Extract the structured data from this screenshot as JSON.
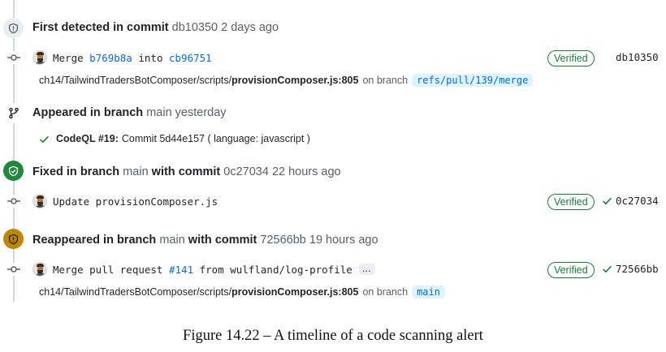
{
  "events": [
    {
      "title_bold": "First detected in commit",
      "title_rest": "db10350 2 days ago"
    },
    {
      "title_bold": "Appeared in branch",
      "title_rest": "main yesterday"
    },
    {
      "title_bold": "Fixed in branch",
      "title_mid": "main",
      "title_bold2": "with commit",
      "title_rest": "0c27034 22 hours ago"
    },
    {
      "title_bold": "Reappeared in branch",
      "title_mid": "main",
      "title_bold2": "with commit",
      "title_rest": "72566bb 19 hours ago"
    }
  ],
  "commits": [
    {
      "prefix": "Merge ",
      "link1": "b769b8a",
      "middle": " into ",
      "link2": "cb96751",
      "badge": "Verified",
      "sha": "db10350"
    },
    {
      "message": "Update provisionComposer.js",
      "badge": "Verified",
      "sha": "0c27034"
    },
    {
      "prefix": "Merge pull request ",
      "link1": "#141",
      "middle": " from wulfland/log-profile",
      "ellipsis": "…",
      "badge": "Verified",
      "sha": "72566bb"
    }
  ],
  "paths": [
    {
      "dir": "ch14/TailwindTradersBotComposer/scripts/",
      "file": "provisionComposer.js:805",
      "on_branch": "on branch",
      "branch": "refs/pull/139/merge"
    },
    {
      "dir": "ch14/TailwindTradersBotComposer/scripts/",
      "file": "provisionComposer.js:805",
      "on_branch": "on branch",
      "branch": "main"
    }
  ],
  "analysis": {
    "name": "CodeQL #19:",
    "rest": "Commit 5d44e157 ( language: javascript )"
  },
  "caption": "Figure 14.22 – A timeline of a code scanning alert",
  "colors": {
    "verified": "#1a7f37",
    "fixed_badge": "#1f883d",
    "reappeared_badge": "#bf8700",
    "link": "#0969da"
  }
}
